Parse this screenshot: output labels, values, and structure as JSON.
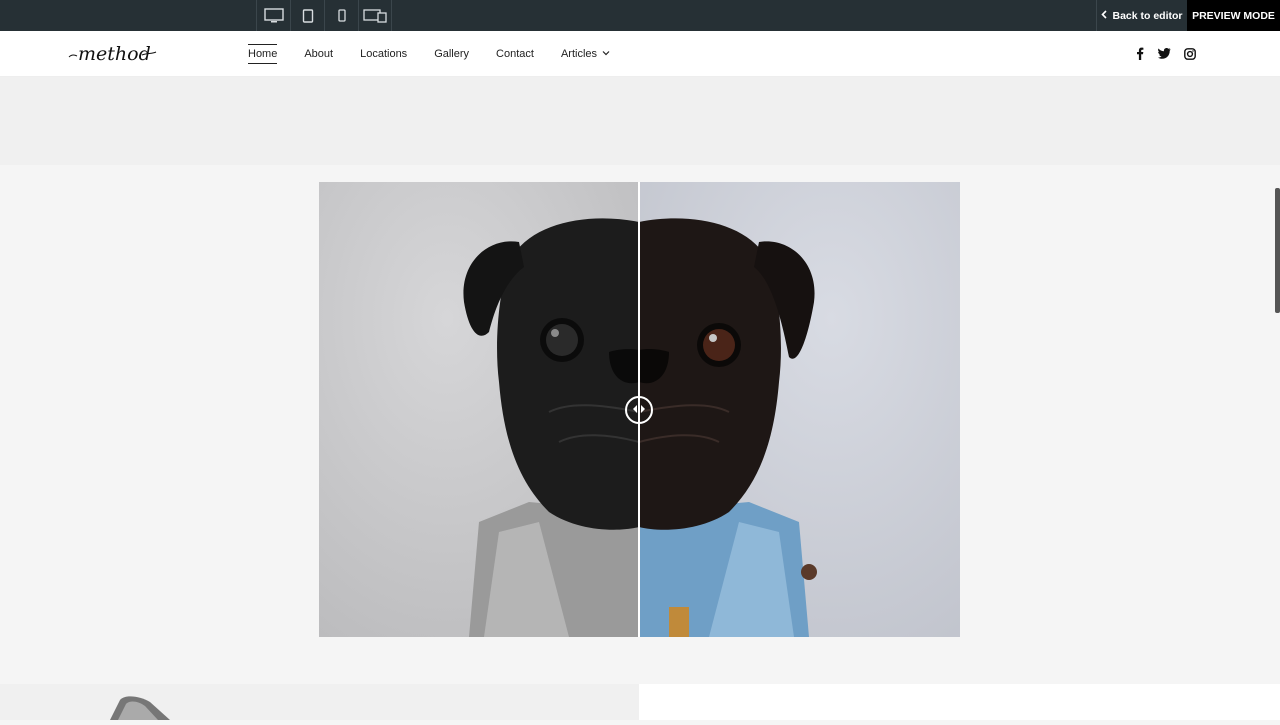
{
  "editor": {
    "device_icons": [
      "desktop-icon",
      "tablet-icon",
      "mobile-icon",
      "responsive-icon"
    ],
    "back_label": "Back to editor",
    "preview_label": "PREVIEW MODE"
  },
  "site": {
    "logo_text": "method",
    "nav": [
      {
        "label": "Home",
        "active": true
      },
      {
        "label": "About"
      },
      {
        "label": "Locations"
      },
      {
        "label": "Gallery"
      },
      {
        "label": "Contact"
      },
      {
        "label": "Articles",
        "has_dropdown": true
      }
    ],
    "social_icons": [
      "facebook-icon",
      "twitter-icon",
      "instagram-icon"
    ]
  },
  "compare": {
    "divider_position": 0.5,
    "left_label": "",
    "right_label": ""
  },
  "colors": {
    "editor_bar": "#263035",
    "preview_bg": "#000000",
    "band": "#f0f0f0",
    "page": "#f5f5f5"
  }
}
